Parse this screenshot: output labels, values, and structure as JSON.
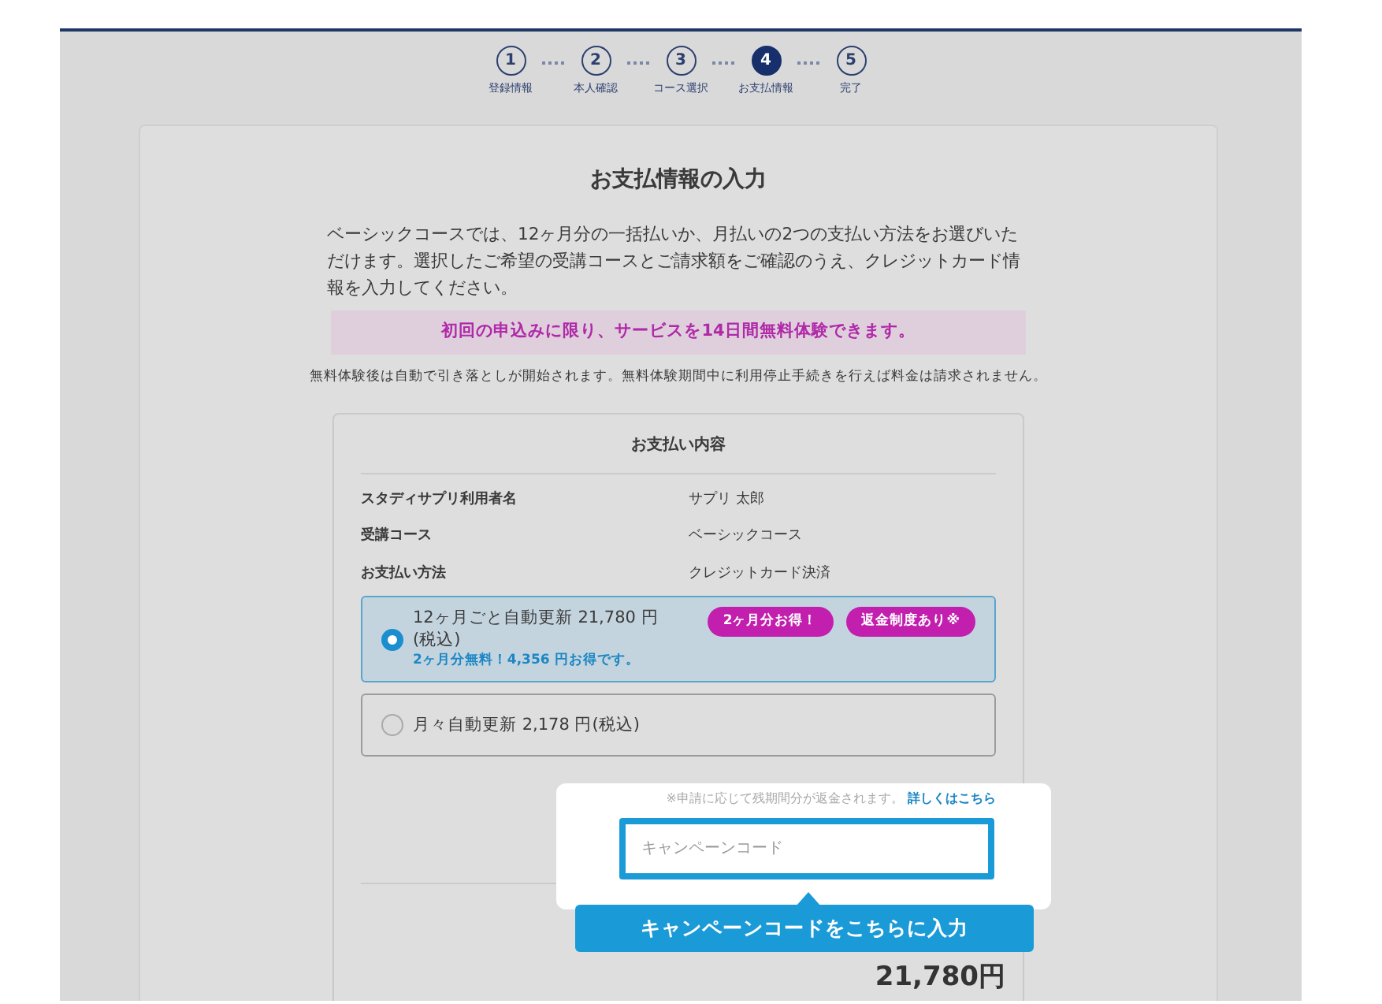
{
  "steps": [
    {
      "number": "1",
      "label": "登録情報",
      "selected": false
    },
    {
      "number": "2",
      "label": "本人確認",
      "selected": false
    },
    {
      "number": "3",
      "label": "コース選択",
      "selected": false
    },
    {
      "number": "4",
      "label": "お支払情報",
      "selected": true
    },
    {
      "number": "5",
      "label": "完了",
      "selected": false
    }
  ],
  "title": "お支払情報の入力",
  "intro": "ベーシックコースでは、12ヶ月分の一括払いか、月払いの2つの支払い方法をお選びいただけます。選択したご希望の受講コースとご請求額をご確認のうえ、クレジットカード情報を入力してください。",
  "trial_banner": "初回の申込みに限り、サービスを14日間無料体験できます。",
  "trial_note": "無料体験後は自動で引き落としが開始されます。無料体験期間中に利用停止手続きを行えば料金は請求されません。",
  "summary": {
    "heading": "お支払い内容",
    "rows": [
      {
        "label": "スタディサプリ利用者名",
        "value": "サプリ 太郎"
      },
      {
        "label": "受講コース",
        "value": "ベーシックコース"
      },
      {
        "label": "お支払い方法",
        "value": "クレジットカード決済"
      }
    ],
    "options": [
      {
        "text": "12ヶ月ごと自動更新 21,780 円(税込)",
        "sub": "2ヶ月分無料！4,356 円お得です。",
        "tags": [
          "2ヶ月分お得！",
          "返金制度あり※"
        ],
        "selected": true
      },
      {
        "text": "月々自動更新 2,178 円(税込)",
        "selected": false
      }
    ]
  },
  "campaign": {
    "refund_note": "※申請に応じて残期間分が返金されます。",
    "details_link": "詳しくはこちら",
    "placeholder": "キャンペーンコード",
    "tooltip": "キャンペーンコードをこちらに入力"
  },
  "total": "21,780円"
}
